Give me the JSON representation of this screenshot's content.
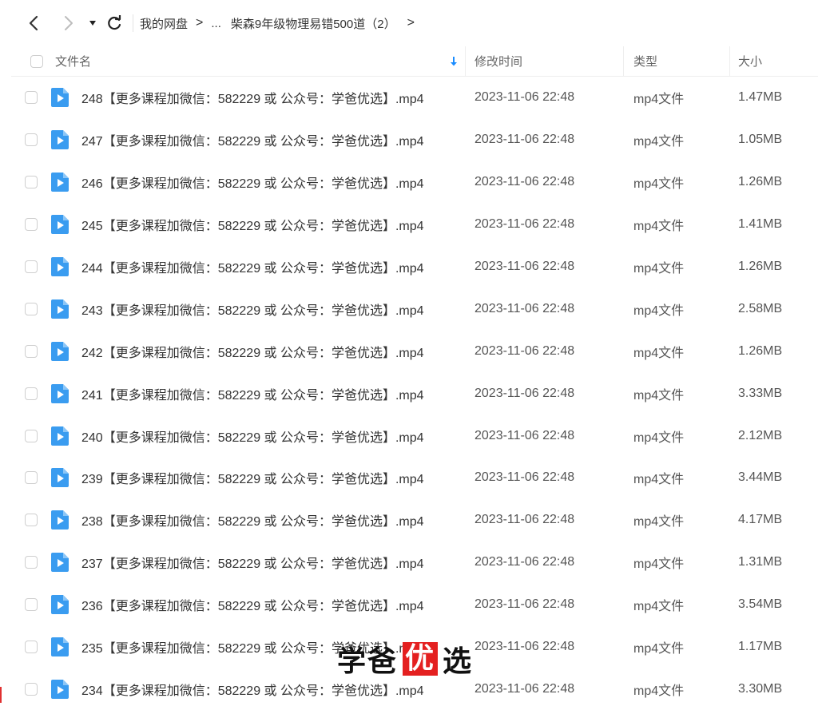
{
  "toolbar": {
    "breadcrumb": {
      "root": "我的网盘",
      "ellipsis": "...",
      "current": "柴森9年级物理易错500道（2）"
    },
    "icons": [
      "back-arrow-icon",
      "forward-arrow-icon",
      "dropdown-caret-icon",
      "refresh-icon"
    ]
  },
  "header": {
    "name": "文件名",
    "modified": "修改时间",
    "type": "类型",
    "size": "大小",
    "sort_icon": "sort-down-arrow-icon"
  },
  "colors": {
    "accent": "#1a8cff",
    "file_icon": "#3a9cf0",
    "watermark_red": "#e42020"
  },
  "files": [
    {
      "name": "248【更多课程加微信：582229 或 公众号：学爸优选】.mp4",
      "modified": "2023-11-06 22:48",
      "type": "mp4文件",
      "size": "1.47MB"
    },
    {
      "name": "247【更多课程加微信：582229 或 公众号：学爸优选】.mp4",
      "modified": "2023-11-06 22:48",
      "type": "mp4文件",
      "size": "1.05MB"
    },
    {
      "name": "246【更多课程加微信：582229 或 公众号：学爸优选】.mp4",
      "modified": "2023-11-06 22:48",
      "type": "mp4文件",
      "size": "1.26MB"
    },
    {
      "name": "245【更多课程加微信：582229 或 公众号：学爸优选】.mp4",
      "modified": "2023-11-06 22:48",
      "type": "mp4文件",
      "size": "1.41MB"
    },
    {
      "name": "244【更多课程加微信：582229 或 公众号：学爸优选】.mp4",
      "modified": "2023-11-06 22:48",
      "type": "mp4文件",
      "size": "1.26MB"
    },
    {
      "name": "243【更多课程加微信：582229 或 公众号：学爸优选】.mp4",
      "modified": "2023-11-06 22:48",
      "type": "mp4文件",
      "size": "2.58MB"
    },
    {
      "name": "242【更多课程加微信：582229 或 公众号：学爸优选】.mp4",
      "modified": "2023-11-06 22:48",
      "type": "mp4文件",
      "size": "1.26MB"
    },
    {
      "name": "241【更多课程加微信：582229 或 公众号：学爸优选】.mp4",
      "modified": "2023-11-06 22:48",
      "type": "mp4文件",
      "size": "3.33MB"
    },
    {
      "name": "240【更多课程加微信：582229 或 公众号：学爸优选】.mp4",
      "modified": "2023-11-06 22:48",
      "type": "mp4文件",
      "size": "2.12MB"
    },
    {
      "name": "239【更多课程加微信：582229 或 公众号：学爸优选】.mp4",
      "modified": "2023-11-06 22:48",
      "type": "mp4文件",
      "size": "3.44MB"
    },
    {
      "name": "238【更多课程加微信：582229 或 公众号：学爸优选】.mp4",
      "modified": "2023-11-06 22:48",
      "type": "mp4文件",
      "size": "4.17MB"
    },
    {
      "name": "237【更多课程加微信：582229 或 公众号：学爸优选】.mp4",
      "modified": "2023-11-06 22:48",
      "type": "mp4文件",
      "size": "1.31MB"
    },
    {
      "name": "236【更多课程加微信：582229 或 公众号：学爸优选】.mp4",
      "modified": "2023-11-06 22:48",
      "type": "mp4文件",
      "size": "3.54MB"
    },
    {
      "name": "235【更多课程加微信：582229 或 公众号：学爸优选】.mp4",
      "modified": "2023-11-06 22:48",
      "type": "mp4文件",
      "size": "1.17MB"
    },
    {
      "name": "234【更多课程加微信：582229 或 公众号：学爸优选】.mp4",
      "modified": "2023-11-06 22:48",
      "type": "mp4文件",
      "size": "3.30MB"
    }
  ],
  "watermark": {
    "part1": "学爸",
    "highlight": "优",
    "part2": "选"
  }
}
